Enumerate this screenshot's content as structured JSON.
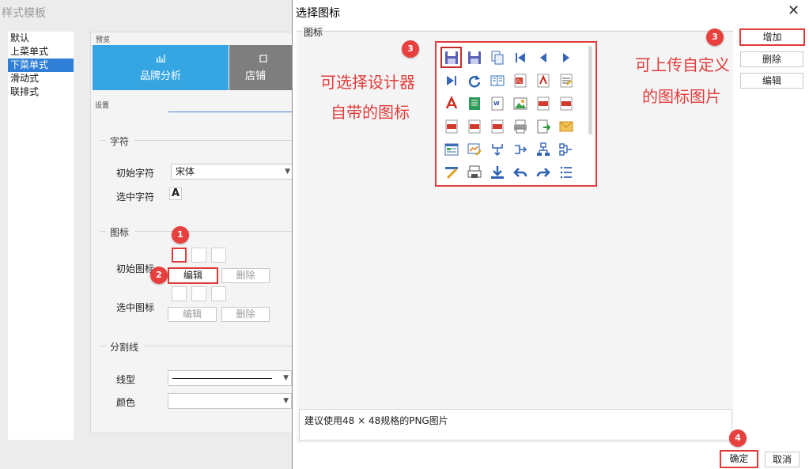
{
  "background_window": {
    "title": "样式模板",
    "style_list": [
      "默认",
      "上菜单式",
      "下菜单式",
      "滑动式",
      "联排式"
    ],
    "selected_style_index": 2,
    "preview_label": "预览",
    "tabs": [
      {
        "label": "品牌分析"
      },
      {
        "label": "店铺"
      }
    ],
    "settings_label": "设置",
    "char_group": {
      "title": "字符",
      "initial_char_label": "初始字符",
      "initial_char_value": "宋体",
      "selected_char_label": "选中字符",
      "selected_char_value": "A"
    },
    "icon_group": {
      "title": "图标",
      "initial_icon_label": "初始图标",
      "selected_icon_label": "选中图标",
      "edit_label": "编辑",
      "delete_label": "删除"
    },
    "divider_group": {
      "title": "分割线",
      "line_type_label": "线型",
      "color_label": "颜色"
    }
  },
  "dialog": {
    "title": "选择图标",
    "close_glyph": "✕",
    "icon_group_label": "图标",
    "hint": "建议使用48 × 48规格的PNG图片",
    "side_buttons": {
      "add": "增加",
      "delete": "删除",
      "edit": "编辑"
    },
    "ok": "确定",
    "cancel": "取消",
    "icons": [
      "save-icon",
      "save-as-icon",
      "copy-page-icon",
      "first-page-icon",
      "prev-page-icon",
      "next-page-icon",
      "last-page-icon",
      "refresh-icon",
      "book-icon",
      "flash-export-icon",
      "pdf-export-icon",
      "word-edit-icon",
      "pdf-icon",
      "excel-icon",
      "word-icon",
      "image-icon",
      "html-icon",
      "svg-icon",
      "jpg-icon",
      "gif-icon",
      "png-icon",
      "print-icon",
      "export-doc-icon",
      "email-icon",
      "form-icon",
      "chart-edit-icon",
      "merge-down-icon",
      "branch-right-icon",
      "tree-down-icon",
      "tree-left-icon",
      "pencil-icon",
      "printer-small-icon",
      "download-icon",
      "undo-icon",
      "redo-icon",
      "list-icon"
    ],
    "selected_icon_index": 0
  },
  "annotations": {
    "badge_1": "1",
    "badge_2": "2",
    "badge_3": "3",
    "badge_4": "4",
    "left_text_line1": "可选择设计器",
    "left_text_line2": "自带的图标",
    "right_text_line1": "可上传自定义",
    "right_text_line2": "的图标图片"
  },
  "colors": {
    "accent_blue": "#36a6e3",
    "selected_list": "#2f7fd6",
    "annotation_red": "#e23b3b"
  }
}
